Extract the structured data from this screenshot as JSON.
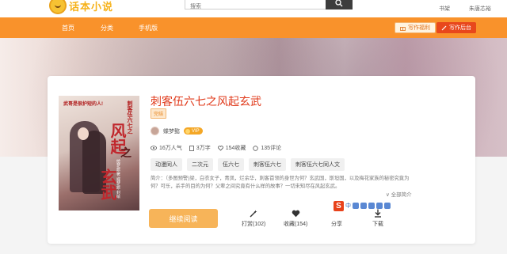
{
  "header": {
    "logo_text": "话本小说",
    "search_placeholder": "搜索",
    "user_links": [
      {
        "label": "书架"
      },
      {
        "label": "朱唐芯裕"
      }
    ]
  },
  "nav": {
    "items": [
      "首页",
      "分类",
      "手机版"
    ],
    "write_welfare": "写作福利",
    "write_backend": "写作后台"
  },
  "book": {
    "title": "刺客伍六七之风起玄武",
    "status": "完结",
    "author": "蝶梦懿",
    "vip": "VIP",
    "stats": {
      "popularity": "16万人气",
      "words": "3万字",
      "favorites": "154收藏",
      "comments": "135评论"
    },
    "tags": [
      "动漫同人",
      "二次元",
      "伍六七",
      "刺客伍六七",
      "刺客伍六七同人文"
    ],
    "intro": "简介：（多图预警)梁，白衣女子，青凤，烂余华，刺客首领的身世为何？玄武国，斯坦国，以及梅花家族的秘密究竟为何？可乐，杀手的目的为何？父辈之间究竟有什么样的故事？一切未知尽在风起玄武。",
    "more": "全部简介",
    "cover": {
      "tagline": "武哥是很护短的人!",
      "side_text": "刺客伍六七之",
      "big1": "风起",
      "big2": "玄武",
      "zhi": "之",
      "authline": "绘梦旅·著 蝶梦旅·封绘"
    }
  },
  "ime": {
    "logo": "S",
    "lang": "中"
  },
  "actions": {
    "read": "继续阅读",
    "reward": "打赏(102)",
    "favorite": "收藏(154)",
    "share": "分享",
    "download": "下载"
  }
}
